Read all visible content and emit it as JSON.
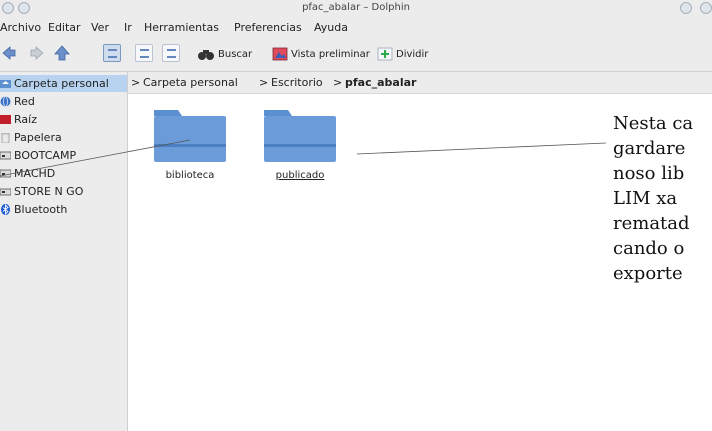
{
  "window": {
    "title": "pfac_abalar – Dolphin"
  },
  "menu": [
    {
      "label": "Archivo"
    },
    {
      "label": "Editar"
    },
    {
      "label": "Ver"
    },
    {
      "label": "Ir"
    },
    {
      "label": "Herramientas"
    },
    {
      "label": "Preferencias"
    },
    {
      "label": "Ayuda"
    }
  ],
  "toolbar": {
    "search_label": "Buscar",
    "preview_label": "Vista preliminar",
    "split_label": "Dividir"
  },
  "sidebar": {
    "items": [
      {
        "label": "Carpeta personal",
        "icon": "home-folder-icon",
        "selected": true
      },
      {
        "label": "Red",
        "icon": "network-icon"
      },
      {
        "label": "Raíz",
        "icon": "root-folder-icon"
      },
      {
        "label": "Papelera",
        "icon": "trash-icon"
      },
      {
        "label": "BOOTCAMP",
        "icon": "drive-icon"
      },
      {
        "label": "MACHD",
        "icon": "drive-icon"
      },
      {
        "label": "STORE N GO",
        "icon": "usb-drive-icon"
      },
      {
        "label": "Bluetooth",
        "icon": "bluetooth-icon"
      }
    ]
  },
  "breadcrumb": {
    "sep": ">",
    "items": [
      "Carpeta personal",
      "Escritorio",
      "pfac_abalar"
    ]
  },
  "folders": [
    {
      "name": "biblioteca"
    },
    {
      "name": "publicado"
    }
  ],
  "annotation": {
    "lines": [
      "Nesta ca",
      "gardare",
      "noso lib",
      "LIM xa",
      "rematad",
      "cando o",
      "exporte"
    ]
  },
  "colors": {
    "selection": "#b7d3ef",
    "folder_blue": "#5b8fcf",
    "chrome": "#ececec"
  }
}
